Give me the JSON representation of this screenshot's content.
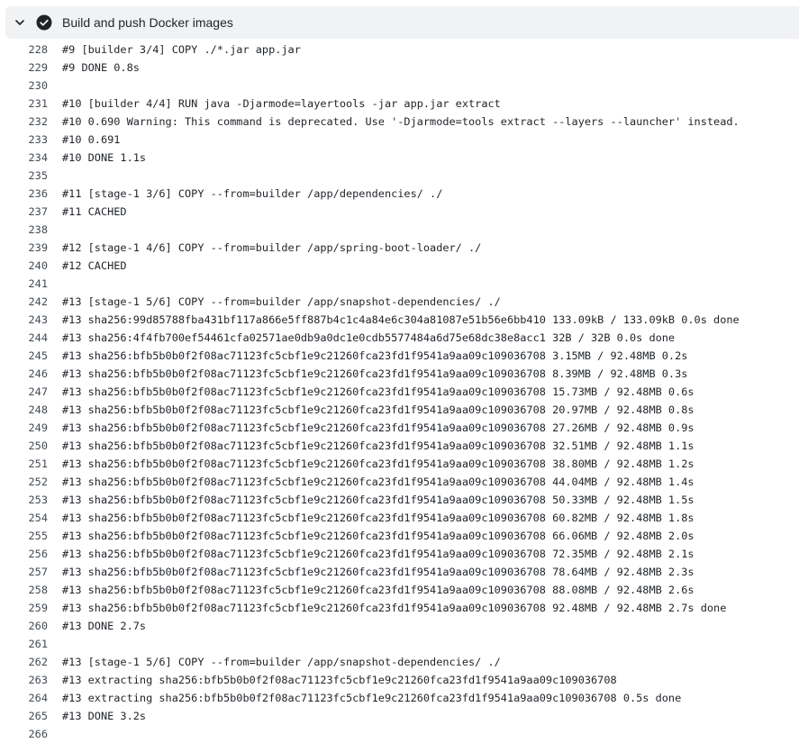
{
  "step": {
    "title": "Build and push Docker images",
    "status_icon": "check-circle-fill-icon",
    "toggle_icon": "chevron-down-icon"
  },
  "log_lines": [
    {
      "num": "228",
      "text": "#9 [builder 3/4] COPY ./*.jar app.jar"
    },
    {
      "num": "229",
      "text": "#9 DONE 0.8s"
    },
    {
      "num": "230",
      "text": ""
    },
    {
      "num": "231",
      "text": "#10 [builder 4/4] RUN java -Djarmode=layertools -jar app.jar extract"
    },
    {
      "num": "232",
      "text": "#10 0.690 Warning: This command is deprecated. Use '-Djarmode=tools extract --layers --launcher' instead."
    },
    {
      "num": "233",
      "text": "#10 0.691"
    },
    {
      "num": "234",
      "text": "#10 DONE 1.1s"
    },
    {
      "num": "235",
      "text": ""
    },
    {
      "num": "236",
      "text": "#11 [stage-1 3/6] COPY --from=builder /app/dependencies/ ./"
    },
    {
      "num": "237",
      "text": "#11 CACHED"
    },
    {
      "num": "238",
      "text": ""
    },
    {
      "num": "239",
      "text": "#12 [stage-1 4/6] COPY --from=builder /app/spring-boot-loader/ ./"
    },
    {
      "num": "240",
      "text": "#12 CACHED"
    },
    {
      "num": "241",
      "text": ""
    },
    {
      "num": "242",
      "text": "#13 [stage-1 5/6] COPY --from=builder /app/snapshot-dependencies/ ./"
    },
    {
      "num": "243",
      "text": "#13 sha256:99d85788fba431bf117a866e5ff887b4c1c4a84e6c304a81087e51b56e6bb410 133.09kB / 133.09kB 0.0s done"
    },
    {
      "num": "244",
      "text": "#13 sha256:4f4fb700ef54461cfa02571ae0db9a0dc1e0cdb5577484a6d75e68dc38e8acc1 32B / 32B 0.0s done"
    },
    {
      "num": "245",
      "text": "#13 sha256:bfb5b0b0f2f08ac71123fc5cbf1e9c21260fca23fd1f9541a9aa09c109036708 3.15MB / 92.48MB 0.2s"
    },
    {
      "num": "246",
      "text": "#13 sha256:bfb5b0b0f2f08ac71123fc5cbf1e9c21260fca23fd1f9541a9aa09c109036708 8.39MB / 92.48MB 0.3s"
    },
    {
      "num": "247",
      "text": "#13 sha256:bfb5b0b0f2f08ac71123fc5cbf1e9c21260fca23fd1f9541a9aa09c109036708 15.73MB / 92.48MB 0.6s"
    },
    {
      "num": "248",
      "text": "#13 sha256:bfb5b0b0f2f08ac71123fc5cbf1e9c21260fca23fd1f9541a9aa09c109036708 20.97MB / 92.48MB 0.8s"
    },
    {
      "num": "249",
      "text": "#13 sha256:bfb5b0b0f2f08ac71123fc5cbf1e9c21260fca23fd1f9541a9aa09c109036708 27.26MB / 92.48MB 0.9s"
    },
    {
      "num": "250",
      "text": "#13 sha256:bfb5b0b0f2f08ac71123fc5cbf1e9c21260fca23fd1f9541a9aa09c109036708 32.51MB / 92.48MB 1.1s"
    },
    {
      "num": "251",
      "text": "#13 sha256:bfb5b0b0f2f08ac71123fc5cbf1e9c21260fca23fd1f9541a9aa09c109036708 38.80MB / 92.48MB 1.2s"
    },
    {
      "num": "252",
      "text": "#13 sha256:bfb5b0b0f2f08ac71123fc5cbf1e9c21260fca23fd1f9541a9aa09c109036708 44.04MB / 92.48MB 1.4s"
    },
    {
      "num": "253",
      "text": "#13 sha256:bfb5b0b0f2f08ac71123fc5cbf1e9c21260fca23fd1f9541a9aa09c109036708 50.33MB / 92.48MB 1.5s"
    },
    {
      "num": "254",
      "text": "#13 sha256:bfb5b0b0f2f08ac71123fc5cbf1e9c21260fca23fd1f9541a9aa09c109036708 60.82MB / 92.48MB 1.8s"
    },
    {
      "num": "255",
      "text": "#13 sha256:bfb5b0b0f2f08ac71123fc5cbf1e9c21260fca23fd1f9541a9aa09c109036708 66.06MB / 92.48MB 2.0s"
    },
    {
      "num": "256",
      "text": "#13 sha256:bfb5b0b0f2f08ac71123fc5cbf1e9c21260fca23fd1f9541a9aa09c109036708 72.35MB / 92.48MB 2.1s"
    },
    {
      "num": "257",
      "text": "#13 sha256:bfb5b0b0f2f08ac71123fc5cbf1e9c21260fca23fd1f9541a9aa09c109036708 78.64MB / 92.48MB 2.3s"
    },
    {
      "num": "258",
      "text": "#13 sha256:bfb5b0b0f2f08ac71123fc5cbf1e9c21260fca23fd1f9541a9aa09c109036708 88.08MB / 92.48MB 2.6s"
    },
    {
      "num": "259",
      "text": "#13 sha256:bfb5b0b0f2f08ac71123fc5cbf1e9c21260fca23fd1f9541a9aa09c109036708 92.48MB / 92.48MB 2.7s done"
    },
    {
      "num": "260",
      "text": "#13 DONE 2.7s"
    },
    {
      "num": "261",
      "text": ""
    },
    {
      "num": "262",
      "text": "#13 [stage-1 5/6] COPY --from=builder /app/snapshot-dependencies/ ./"
    },
    {
      "num": "263",
      "text": "#13 extracting sha256:bfb5b0b0f2f08ac71123fc5cbf1e9c21260fca23fd1f9541a9aa09c109036708"
    },
    {
      "num": "264",
      "text": "#13 extracting sha256:bfb5b0b0f2f08ac71123fc5cbf1e9c21260fca23fd1f9541a9aa09c109036708 0.5s done"
    },
    {
      "num": "265",
      "text": "#13 DONE 3.2s"
    },
    {
      "num": "266",
      "text": ""
    }
  ]
}
